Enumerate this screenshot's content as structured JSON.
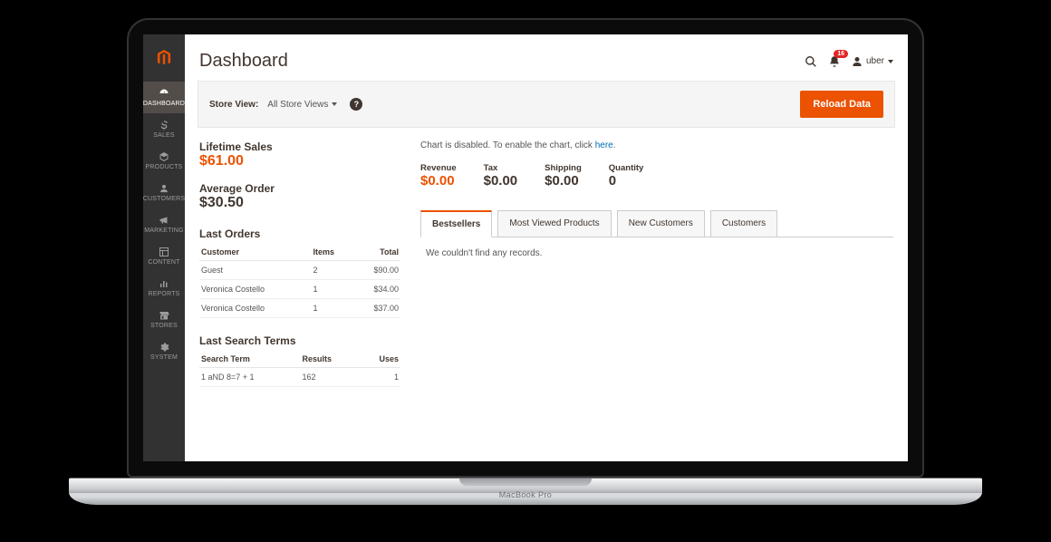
{
  "deck_label": "MacBook Pro",
  "sidebar": {
    "items": [
      {
        "label": "DASHBOARD",
        "icon": "dashboard-icon",
        "active": true
      },
      {
        "label": "SALES",
        "icon": "dollar-icon"
      },
      {
        "label": "PRODUCTS",
        "icon": "cube-icon"
      },
      {
        "label": "CUSTOMERS",
        "icon": "person-icon"
      },
      {
        "label": "MARKETING",
        "icon": "megaphone-icon"
      },
      {
        "label": "CONTENT",
        "icon": "layout-icon"
      },
      {
        "label": "REPORTS",
        "icon": "bars-icon"
      },
      {
        "label": "STORES",
        "icon": "storefront-icon"
      },
      {
        "label": "SYSTEM",
        "icon": "gear-icon"
      }
    ]
  },
  "header": {
    "title": "Dashboard",
    "notifications_count": "16",
    "username": "uber"
  },
  "toolbar": {
    "store_view_label": "Store View:",
    "store_view_value": "All Store Views",
    "reload_label": "Reload Data"
  },
  "left": {
    "lifetime_sales_label": "Lifetime Sales",
    "lifetime_sales_value": "$61.00",
    "avg_order_label": "Average Order",
    "avg_order_value": "$30.50",
    "last_orders_header": "Last Orders",
    "orders_columns": {
      "customer": "Customer",
      "items": "Items",
      "total": "Total"
    },
    "orders": [
      {
        "customer": "Guest",
        "items": "2",
        "total": "$90.00"
      },
      {
        "customer": "Veronica Costello",
        "items": "1",
        "total": "$34.00"
      },
      {
        "customer": "Veronica Costello",
        "items": "1",
        "total": "$37.00"
      }
    ],
    "last_search_header": "Last Search Terms",
    "search_columns": {
      "term": "Search Term",
      "results": "Results",
      "uses": "Uses"
    },
    "searches": [
      {
        "term": "1 aND 8=7 + 1",
        "results": "162",
        "uses": "1"
      }
    ]
  },
  "right": {
    "chart_msg_prefix": "Chart is disabled. To enable the chart, click ",
    "chart_msg_link": "here",
    "chart_msg_suffix": ".",
    "kpis": [
      {
        "label": "Revenue",
        "value": "$0.00",
        "accent": true
      },
      {
        "label": "Tax",
        "value": "$0.00"
      },
      {
        "label": "Shipping",
        "value": "$0.00"
      },
      {
        "label": "Quantity",
        "value": "0"
      }
    ],
    "tabs": [
      {
        "label": "Bestsellers",
        "active": true
      },
      {
        "label": "Most Viewed Products"
      },
      {
        "label": "New Customers"
      },
      {
        "label": "Customers"
      }
    ],
    "tab_body_empty": "We couldn't find any records."
  }
}
